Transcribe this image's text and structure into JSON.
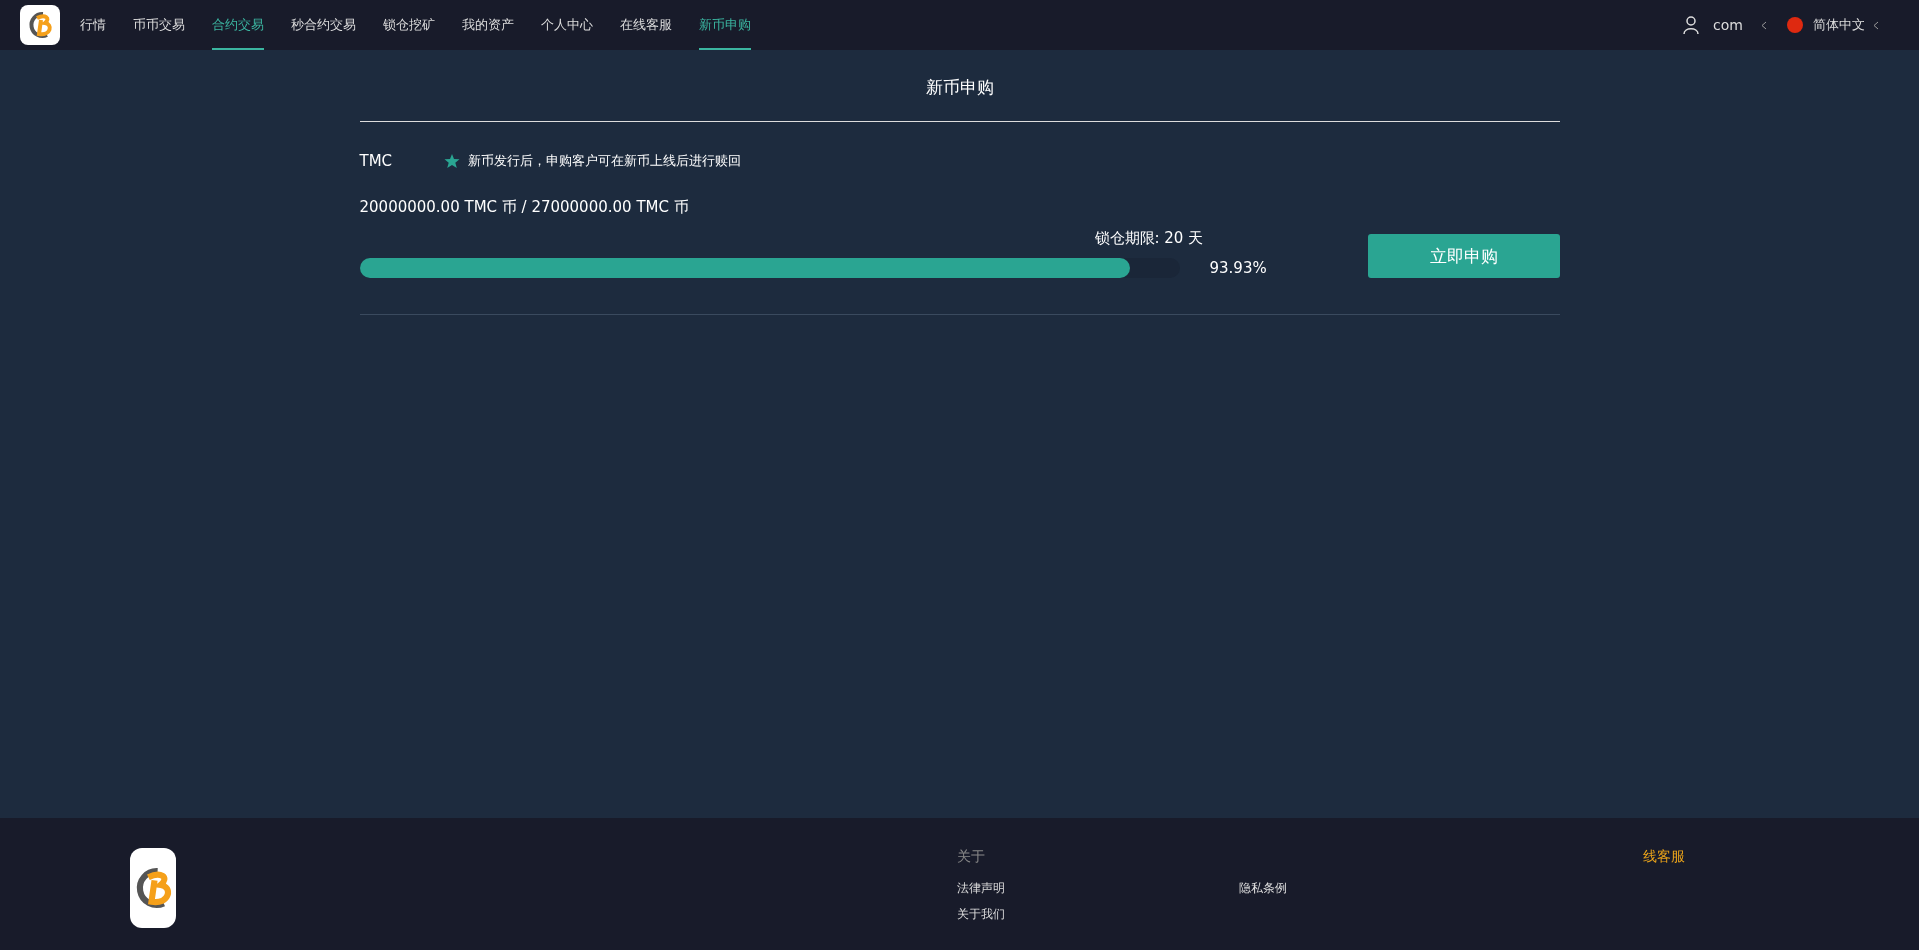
{
  "nav": {
    "items": [
      {
        "label": "行情",
        "selected": false
      },
      {
        "label": "币币交易",
        "selected": false
      },
      {
        "label": "合约交易",
        "selected": true
      },
      {
        "label": "秒合约交易",
        "selected": false
      },
      {
        "label": "锁仓挖矿",
        "selected": false
      },
      {
        "label": "我的资产",
        "selected": false
      },
      {
        "label": "个人中心",
        "selected": false
      },
      {
        "label": "在线客服",
        "selected": false
      },
      {
        "label": "新币申购",
        "selected": true
      }
    ],
    "user": "com",
    "language": "简体中文"
  },
  "page": {
    "title": "新币申购",
    "coin": "TMC",
    "note": "新币发行后，申购客户可在新币上线后进行赎回",
    "amount": "20000000.00 TMC 币  /  27000000.00 TMC 币",
    "lock": "锁仓期限: 20 天",
    "progress": {
      "level": 0.9393,
      "reading": "93.93%"
    },
    "button": "立即申购"
  },
  "footer": {
    "columns": [
      {
        "title": "关于",
        "links": [
          "法律声明",
          "关于我们"
        ]
      },
      {
        "links": [
          "隐私条例"
        ]
      },
      {
        "title": "线客服"
      }
    ]
  }
}
